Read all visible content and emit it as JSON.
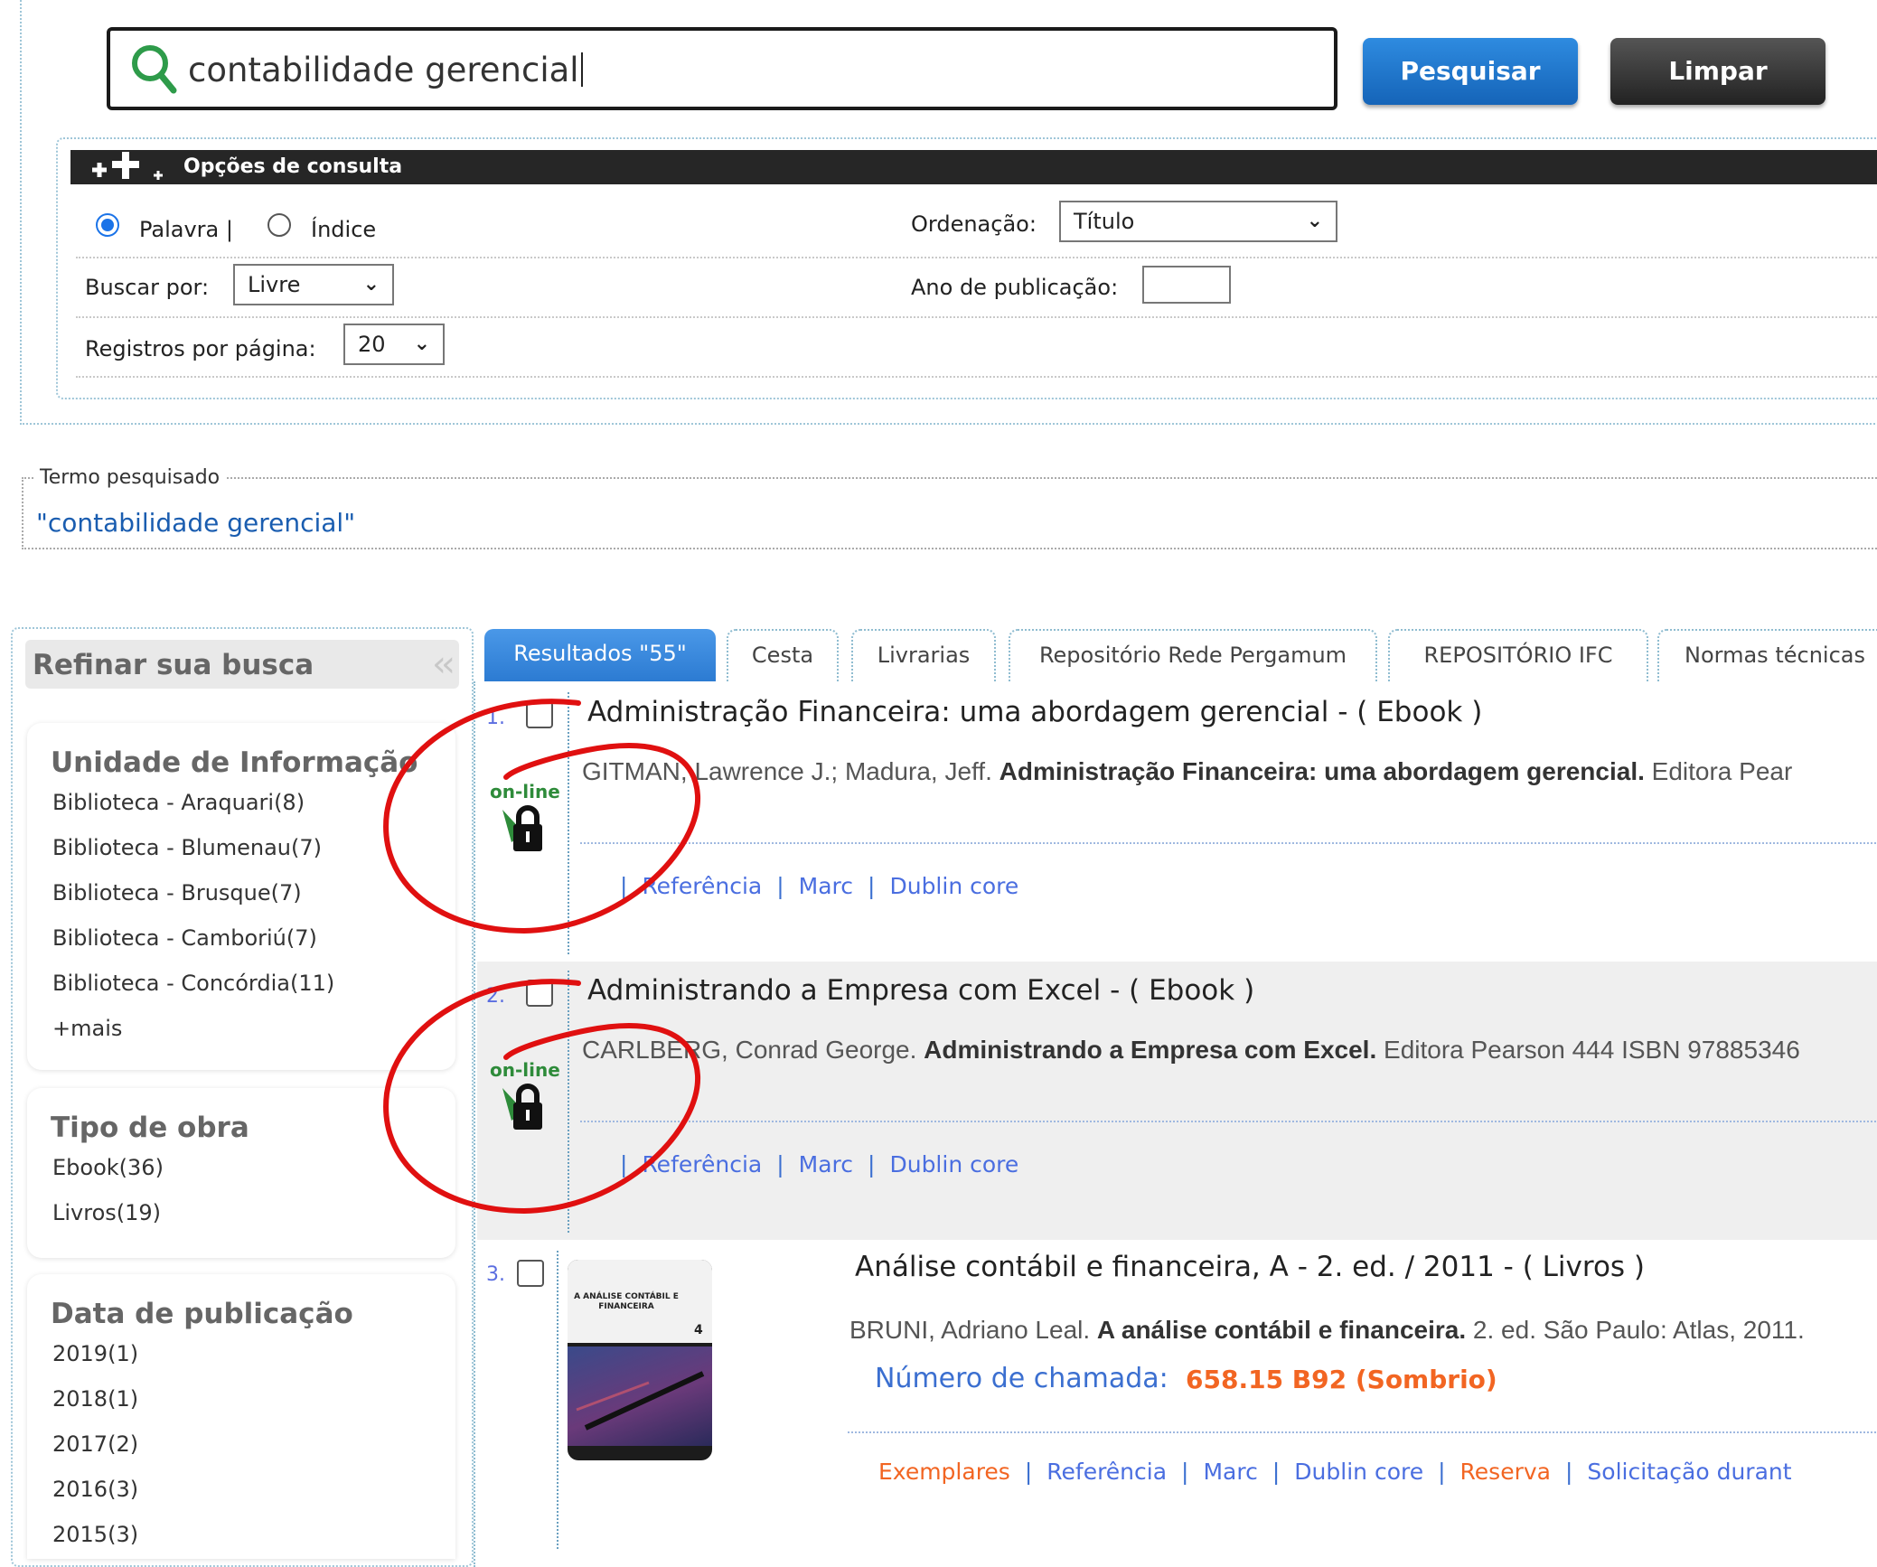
{
  "search": {
    "query": "contabilidade gerencial",
    "search_button": "Pesquisar",
    "clear_button": "Limpar"
  },
  "options": {
    "header": "Opções de consulta",
    "radio_word": "Palavra |",
    "radio_index": "Índice",
    "radio_selected": "Palavra",
    "order_label": "Ordenação:",
    "order_value": "Título",
    "search_by_label": "Buscar por:",
    "search_by_value": "Livre",
    "year_label": "Ano de publicação:",
    "year_value": "",
    "per_page_label": "Registros por página:",
    "per_page_value": "20"
  },
  "term": {
    "legend": "Termo pesquisado",
    "value": "\"contabilidade gerencial\""
  },
  "sidebar": {
    "title": "Refinar sua busca",
    "facets": [
      {
        "title": "Unidade de Informação",
        "items": [
          "Biblioteca - Araquari(8)",
          "Biblioteca - Blumenau(7)",
          "Biblioteca - Brusque(7)",
          "Biblioteca - Camboriú(7)",
          "Biblioteca - Concórdia(11)",
          "+mais"
        ]
      },
      {
        "title": "Tipo de obra",
        "items": [
          "Ebook(36)",
          "Livros(19)"
        ]
      },
      {
        "title": "Data de publicação",
        "items": [
          "2019(1)",
          "2018(1)",
          "2017(2)",
          "2016(3)",
          "2015(3)"
        ]
      }
    ]
  },
  "tabs": [
    {
      "label": "Resultados \"55\"",
      "active": true
    },
    {
      "label": "Cesta",
      "active": false
    },
    {
      "label": "Livrarias",
      "active": false
    },
    {
      "label": "Repositório Rede Pergamum",
      "active": false
    },
    {
      "label": "REPOSITÓRIO IFC",
      "active": false
    },
    {
      "label": "Normas técnicas",
      "active": false
    }
  ],
  "results": [
    {
      "num": "1.",
      "title": "Administração Financeira: uma abordagem gerencial - ( Ebook )",
      "author": "GITMAN, Lawrence J.; Madura, Jeff. ",
      "book_title": "Administração Financeira: uma abordagem gerencial.",
      "rest": " Editora Pear",
      "online": "on-line",
      "links": [
        "Referência",
        "Marc",
        "Dublin core"
      ]
    },
    {
      "num": "2.",
      "title": "Administrando a Empresa com Excel - ( Ebook )",
      "author": "CARLBERG, Conrad George. ",
      "book_title": "Administrando a Empresa com Excel.",
      "rest": " Editora Pearson 444 ISBN 97885346",
      "online": "on-line",
      "links": [
        "Referência",
        "Marc",
        "Dublin core"
      ]
    },
    {
      "num": "3.",
      "title": "Análise contábil e financeira, A - 2. ed. / 2011 - ( Livros )",
      "author": "BRUNI, Adriano Leal. ",
      "book_title": "A análise contábil e financeira.",
      "rest": " 2. ed. São Paulo: Atlas, 2011.",
      "call_label": "Número de chamada:",
      "call_value": "658.15 B92 (Sombrio)",
      "cover_title": "A ANÁLISE CONTÁBIL E FINANCEIRA",
      "cover_number": "4",
      "links": [
        "Exemplares",
        "Referência",
        "Marc",
        "Dublin core",
        "Reserva",
        "Solicitação durant"
      ]
    }
  ],
  "colors": {
    "accent_blue": "#2c7bd2",
    "link_blue": "#4a6ee0",
    "orange": "#f26522",
    "annotation_red": "#e01010"
  }
}
